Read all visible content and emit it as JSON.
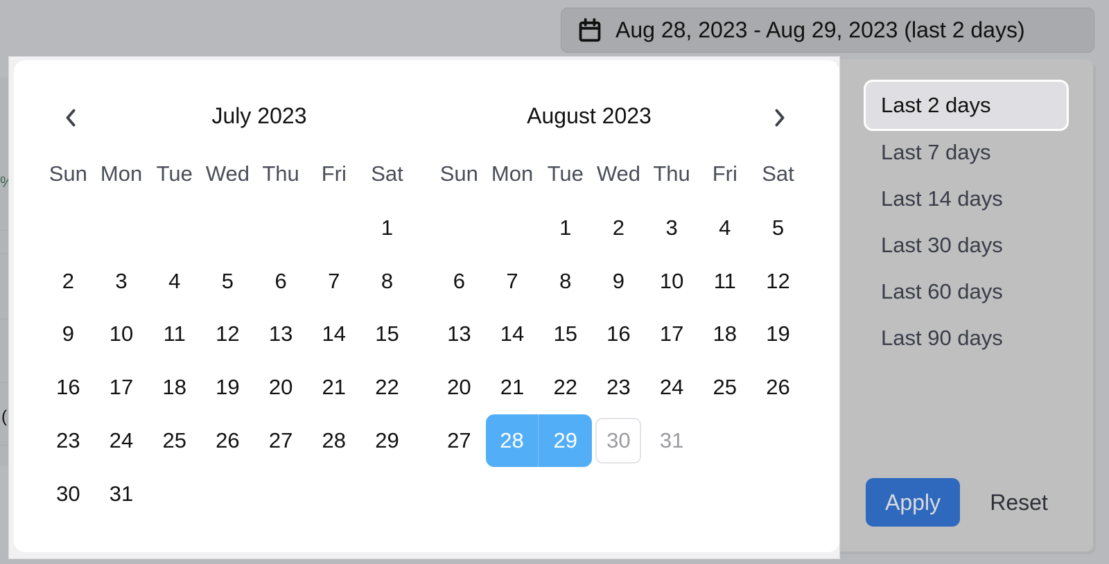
{
  "trigger": {
    "icon": "calendar-icon",
    "label": "Aug 28, 2023 - Aug 29, 2023 (last 2 days)"
  },
  "background": {
    "peek_text_1": "%",
    "peek_text_2": "("
  },
  "calendar": {
    "prev_icon": "chevron-left-icon",
    "next_icon": "chevron-right-icon",
    "weekdays": [
      "Sun",
      "Mon",
      "Tue",
      "Wed",
      "Thu",
      "Fri",
      "Sat"
    ],
    "months": [
      {
        "title": "July 2023",
        "weeks": [
          [
            "",
            "",
            "",
            "",
            "",
            "",
            "1"
          ],
          [
            "2",
            "3",
            "4",
            "5",
            "6",
            "7",
            "8"
          ],
          [
            "9",
            "10",
            "11",
            "12",
            "13",
            "14",
            "15"
          ],
          [
            "16",
            "17",
            "18",
            "19",
            "20",
            "21",
            "22"
          ],
          [
            "23",
            "24",
            "25",
            "26",
            "27",
            "28",
            "29"
          ],
          [
            "30",
            "31",
            "",
            "",
            "",
            "",
            ""
          ]
        ]
      },
      {
        "title": "August 2023",
        "weeks": [
          [
            "",
            "",
            "1",
            "2",
            "3",
            "4",
            "5"
          ],
          [
            "6",
            "7",
            "8",
            "9",
            "10",
            "11",
            "12"
          ],
          [
            "13",
            "14",
            "15",
            "16",
            "17",
            "18",
            "19"
          ],
          [
            "20",
            "21",
            "22",
            "23",
            "24",
            "25",
            "26"
          ],
          [
            "27",
            "28",
            "29",
            "30",
            "31",
            "",
            ""
          ]
        ]
      }
    ],
    "selection": {
      "month_index": 1,
      "start_day": "28",
      "end_day": "29"
    },
    "today": {
      "month_index": 1,
      "day": "30"
    },
    "disabled_after": {
      "month_index": 1,
      "day": "29"
    },
    "colors": {
      "selected_bg": "#53aef8",
      "selected_text": "#ffffff",
      "disabled_text": "#9b9ba0"
    }
  },
  "presets": {
    "items": [
      {
        "label": "Last 2 days",
        "active": true
      },
      {
        "label": "Last 7 days",
        "active": false
      },
      {
        "label": "Last 14 days",
        "active": false
      },
      {
        "label": "Last 30 days",
        "active": false
      },
      {
        "label": "Last 60 days",
        "active": false
      },
      {
        "label": "Last 90 days",
        "active": false
      }
    ],
    "apply_label": "Apply",
    "reset_label": "Reset",
    "apply_color": "#2f69bd"
  }
}
